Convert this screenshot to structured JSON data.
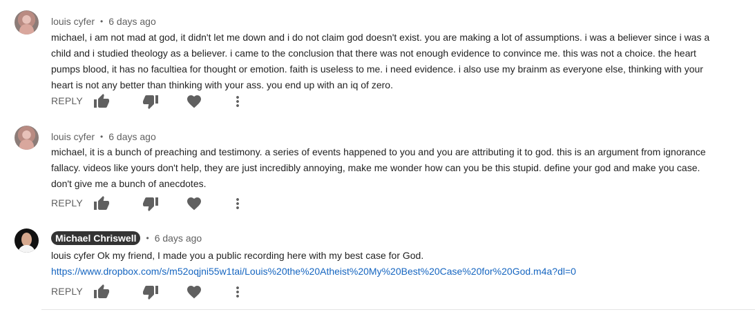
{
  "comments": [
    {
      "author": "louis cyfer",
      "age": "6 days ago",
      "text": "michael, i am not mad at god, it didn't let me down and i do not claim god doesn't exist. you are making a lot of assumptions. i was a believer since i was a child and i studied theology as a believer. i came to the conclusion that there was not enough evidence to convince me. this was not a choice. the heart pumps blood, it has no facultiea for thought or emotion. faith is useless to me. i need evidence. i also use my brainm as everyone else, thinking with your heart is not any better than thinking with your ass. you end up with an iq of zero.",
      "reply_label": "REPLY"
    },
    {
      "author": "louis cyfer",
      "age": "6 days ago",
      "text": "michael, it is a bunch of preaching and testimony. a series of events happened to you and you are attributing it to god. this is an argument from ignorance fallacy. videos like yours don't help, they are just incredibly annoying, make me wonder how can you be this stupid. define your god and make you case. don't give me a bunch of anecdotes.",
      "reply_label": "REPLY"
    },
    {
      "author": "Michael Chriswell",
      "age": "6 days ago",
      "text": "louis cyfer Ok my friend, I made you a public recording here with my best case for God.",
      "link": "https://www.dropbox.com/s/m52oqjni55w1tai/Louis%20the%20Atheist%20My%20Best%20Case%20for%20God.m4a?dl=0",
      "reply_label": "REPLY"
    }
  ],
  "separator": "•",
  "icons": {
    "like": "thumbs-up-icon",
    "dislike": "thumbs-down-icon",
    "heart": "heart-icon",
    "more": "more-vert-icon"
  },
  "colors": {
    "meta_text": "#606060",
    "body_text": "#222222",
    "icon": "#606060",
    "link": "#1565c0",
    "creator_badge_bg": "#333333"
  }
}
